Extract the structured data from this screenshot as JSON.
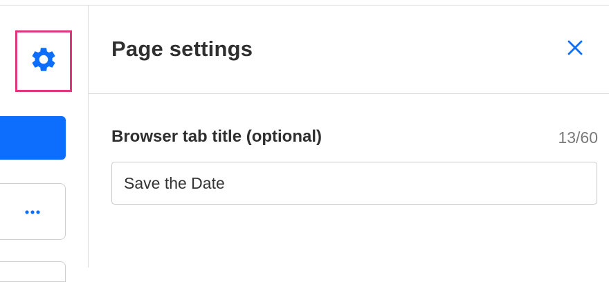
{
  "panel": {
    "title": "Page settings",
    "close_icon": "close-icon"
  },
  "rail": {
    "settings_icon": "gear-icon",
    "more_icon": "ellipsis-icon"
  },
  "field": {
    "label": "Browser tab title (optional)",
    "count": "13/60",
    "value": "Save the Date"
  },
  "colors": {
    "accent": "#0d6efd",
    "highlight": "#e0367f"
  }
}
